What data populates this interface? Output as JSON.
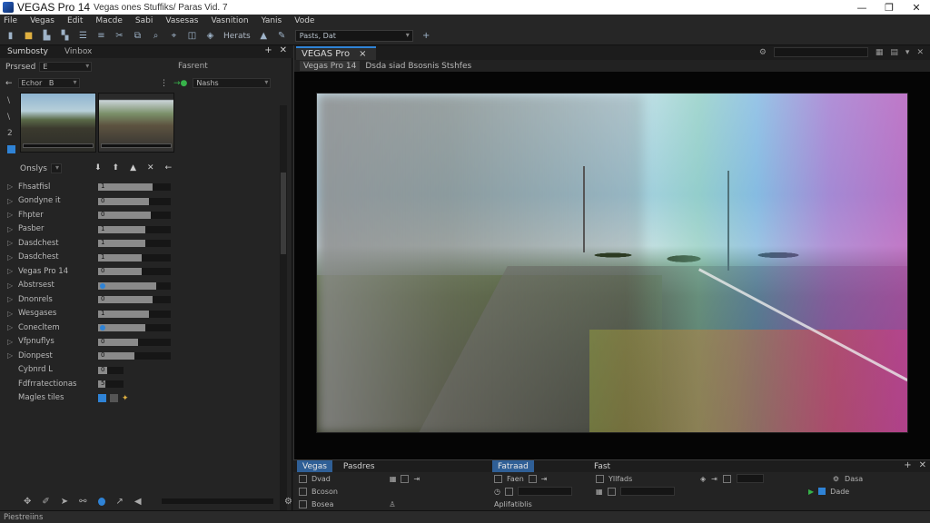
{
  "titlebar": {
    "title": "VEGAS Pro 14",
    "subtitle": "Vegas ones Stuffiks/ Paras Vid. 7",
    "controls": [
      "—",
      "❐",
      "✕"
    ]
  },
  "menu": [
    "File",
    "Vegas",
    "Edit",
    "Macde",
    "Sabi",
    "Vasesas",
    "Vasnition",
    "Yanis",
    "Vode"
  ],
  "toolbar": {
    "label": "Herats",
    "dropdown": "Pasts, Dat"
  },
  "left_panel": {
    "tabs": [
      "Sumbosty",
      "Vinbox"
    ],
    "preset_label": "Prsrsed",
    "preset_value": "E",
    "fx_label": "Fasrent",
    "filter_value": "Echor",
    "filter_sub": "B",
    "right_label": "Nashs",
    "side_links": [
      "\\",
      "\\",
      "2",
      "\\"
    ],
    "grid_head": "Onslys",
    "params": [
      {
        "label": "Fhsatfisl",
        "value": "1",
        "fill": 0.75,
        "type": "bar"
      },
      {
        "label": "Gondyne it",
        "value": "0",
        "fill": 0.7,
        "type": "bar"
      },
      {
        "label": "Fhpter",
        "value": "0",
        "fill": 0.72,
        "type": "bar"
      },
      {
        "label": "Pasber",
        "value": "1",
        "fill": 0.65,
        "type": "bar"
      },
      {
        "label": "Dasdchest",
        "value": "1",
        "fill": 0.65,
        "type": "bar"
      },
      {
        "label": "Dasdchest",
        "value": "1",
        "fill": 0.6,
        "type": "bar"
      },
      {
        "label": "Vegas Pro 14",
        "value": "0",
        "fill": 0.6,
        "type": "bar"
      },
      {
        "label": "Abstrsest",
        "value": "",
        "fill": 0.8,
        "type": "knob"
      },
      {
        "label": "Dnonrels",
        "value": "0",
        "fill": 0.75,
        "type": "bar"
      },
      {
        "label": "Wesgases",
        "value": "1",
        "fill": 0.7,
        "type": "bar"
      },
      {
        "label": "Conecltem",
        "value": "",
        "fill": 0.65,
        "type": "knob"
      },
      {
        "label": "Vfpnuflys",
        "value": "0",
        "fill": 0.55,
        "type": "bar"
      },
      {
        "label": "Dionpest",
        "value": "0",
        "fill": 0.5,
        "type": "bar"
      },
      {
        "label": "Cybnrd L",
        "value": "0",
        "fill": 0.35,
        "type": "short"
      },
      {
        "label": "Fdfrratectionas",
        "value": "5",
        "fill": 0.3,
        "type": "short"
      },
      {
        "label": "Magles tiles",
        "value": "",
        "fill": 0,
        "type": "mbr"
      }
    ]
  },
  "preview": {
    "tab": "VEGAS Pro",
    "tab_close": "×",
    "sub_tab": "Vegas Pro 14",
    "sub_text": "Dsda siad Bsosnis Stshfes"
  },
  "bottom": {
    "sections": [
      {
        "tabs": [
          "Vegas",
          "Pasdres"
        ],
        "lines": [
          "Dvad",
          "Bcoson",
          "Bosea"
        ]
      },
      {
        "tabs": [
          "Fatraad"
        ],
        "lines": [
          "Faen",
          "Aplifatiblis"
        ]
      },
      {
        "tabs": [
          "Fast"
        ],
        "lines": [
          "Yllfads",
          ""
        ]
      },
      {
        "tabs": [
          ""
        ],
        "lines": [
          "Dasa",
          "Dade"
        ]
      }
    ]
  },
  "status": "Piestreiins",
  "colors": {
    "accent": "#2f83d6",
    "bg": "#1e1e1e",
    "panel": "#242424"
  }
}
